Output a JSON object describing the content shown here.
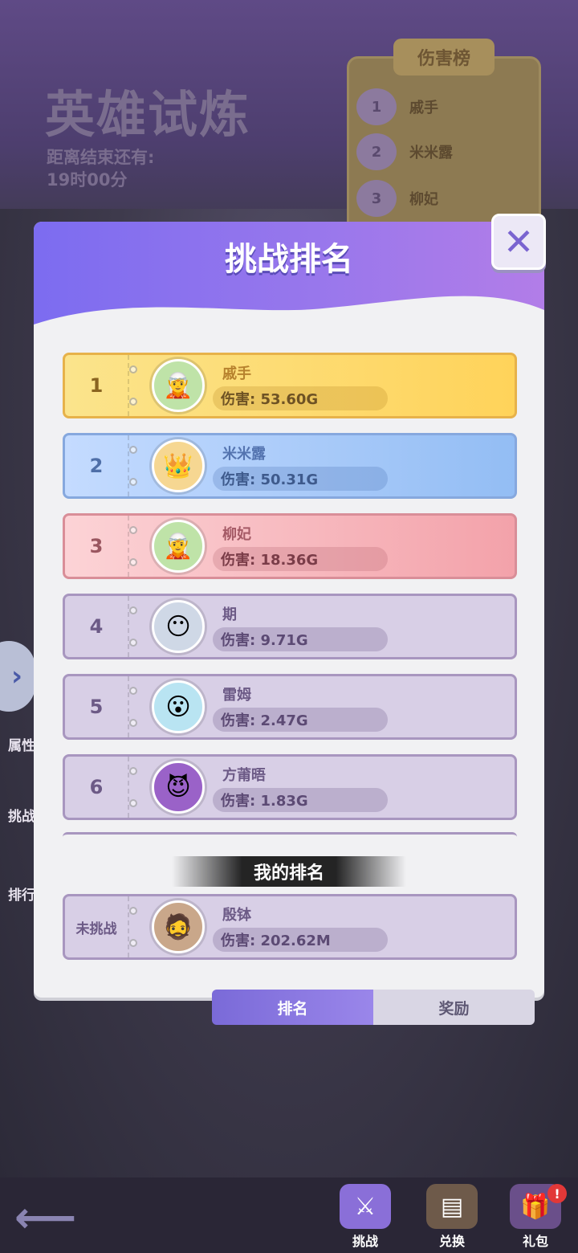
{
  "background": {
    "event_title": "英雄试炼",
    "countdown_label": "距离结束还有:",
    "countdown_value": "19时00分",
    "damage_board": {
      "title": "伤害榜",
      "entries": [
        {
          "rank": "1",
          "name": "戚手"
        },
        {
          "rank": "2",
          "name": "米米露"
        },
        {
          "rank": "3",
          "name": "柳妃"
        }
      ]
    },
    "side_menu": [
      {
        "label": "属性"
      },
      {
        "label": "挑战"
      },
      {
        "label": "排行"
      }
    ]
  },
  "modal": {
    "title": "挑战排名",
    "close_icon": "close-icon",
    "rankings": [
      {
        "rank": "1",
        "name": "戚手",
        "damage": "伤害: 53.60G",
        "style": "gold"
      },
      {
        "rank": "2",
        "name": "米米露",
        "damage": "伤害: 50.31G",
        "style": "blue"
      },
      {
        "rank": "3",
        "name": "柳妃",
        "damage": "伤害: 18.36G",
        "style": "red"
      },
      {
        "rank": "4",
        "name": "期",
        "damage": "伤害: 9.71G",
        "style": "normal"
      },
      {
        "rank": "5",
        "name": "雷姆",
        "damage": "伤害: 2.47G",
        "style": "normal"
      },
      {
        "rank": "6",
        "name": "方莆晤",
        "damage": "伤害: 1.83G",
        "style": "normal"
      }
    ],
    "my_rank_label": "我的排名",
    "my_rank": {
      "rank": "未挑战",
      "name": "殷钵",
      "damage": "伤害: 202.62M"
    }
  },
  "tabs": [
    {
      "label": "排名",
      "active": true
    },
    {
      "label": "奖励",
      "active": false
    }
  ],
  "bottom_nav": [
    {
      "label": "挑战",
      "icon": "swords-icon"
    },
    {
      "label": "兑换",
      "icon": "shop-icon"
    },
    {
      "label": "礼包",
      "icon": "gift-icon",
      "badge": "!"
    }
  ],
  "colors": {
    "accent": "#8b74ec",
    "gold_row": "#ffd35a",
    "blue_row": "#93bdf4",
    "red_row": "#f3a2aa",
    "normal_row": "#d8cfe6"
  }
}
